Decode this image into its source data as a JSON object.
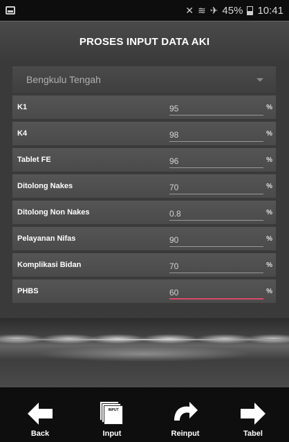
{
  "status_bar": {
    "battery": "45%",
    "time": "10:41"
  },
  "header": {
    "title": "PROSES INPUT DATA AKI"
  },
  "region_select": {
    "value": "Bengkulu Tengah"
  },
  "fields": [
    {
      "label": "K1",
      "value": "95",
      "unit": "%"
    },
    {
      "label": "K4",
      "value": "98",
      "unit": "%"
    },
    {
      "label": "Tablet FE",
      "value": "96",
      "unit": "%"
    },
    {
      "label": "Ditolong Nakes",
      "value": "70",
      "unit": "%"
    },
    {
      "label": "Ditolong Non Nakes",
      "value": "0.8",
      "unit": "%"
    },
    {
      "label": "Pelayanan Nifas",
      "value": "90",
      "unit": "%"
    },
    {
      "label": "Komplikasi Bidan",
      "value": "70",
      "unit": "%"
    },
    {
      "label": "PHBS",
      "value": "60",
      "unit": "%"
    }
  ],
  "nav": {
    "back": "Back",
    "input": "Input",
    "input_icon_text": "INPUT",
    "reinput": "Reinput",
    "tabel": "Tabel"
  },
  "colors": {
    "active_underline": "#d94a6a",
    "row_bg": "#4f4f4f",
    "nav_bg": "#0e0e0e"
  }
}
